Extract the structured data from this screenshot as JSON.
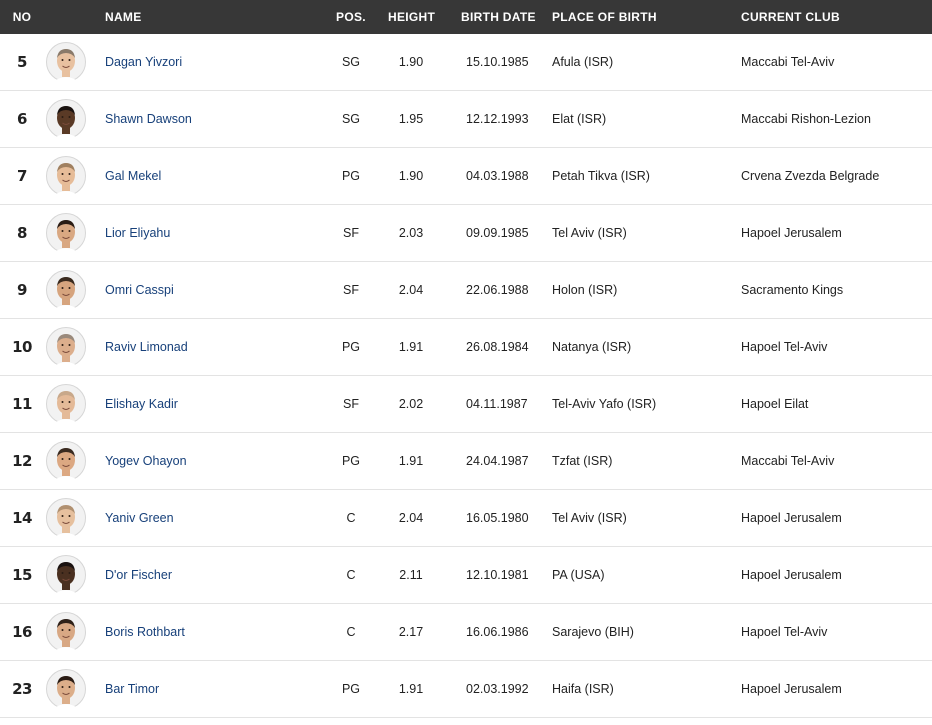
{
  "headers": {
    "no": "NO",
    "name": "NAME",
    "pos": "POS.",
    "height": "HEIGHT",
    "birth_date": "BIRTH DATE",
    "place_of_birth": "PLACE OF BIRTH",
    "current_club": "CURRENT CLUB"
  },
  "colors": {
    "header_bg": "#373737",
    "name_link": "#17407a",
    "row_divider": "#e3e3e3"
  },
  "players": [
    {
      "no": "5",
      "name": "Dagan Yivzori",
      "pos": "SG",
      "height": "1.90",
      "birth_date": "15.10.1985",
      "place": "Afula (ISR)",
      "club": "Maccabi Tel-Aviv",
      "skin": "#e8c1a0",
      "hair": "#8a7a6a"
    },
    {
      "no": "6",
      "name": "Shawn Dawson",
      "pos": "SG",
      "height": "1.95",
      "birth_date": "12.12.1993",
      "place": "Elat (ISR)",
      "club": "Maccabi Rishon-Lezion",
      "skin": "#5a3a26",
      "hair": "#1a1210"
    },
    {
      "no": "7",
      "name": "Gal Mekel",
      "pos": "PG",
      "height": "1.90",
      "birth_date": "04.03.1988",
      "place": "Petah Tikva (ISR)",
      "club": "Crvena Zvezda Belgrade",
      "skin": "#e6bc98",
      "hair": "#a08060"
    },
    {
      "no": "8",
      "name": "Lior Eliyahu",
      "pos": "SF",
      "height": "2.03",
      "birth_date": "09.09.1985",
      "place": "Tel Aviv (ISR)",
      "club": "Hapoel Jerusalem",
      "skin": "#d9a882",
      "hair": "#2a1c14"
    },
    {
      "no": "9",
      "name": "Omri Casspi",
      "pos": "SF",
      "height": "2.04",
      "birth_date": "22.06.1988",
      "place": "Holon (ISR)",
      "club": "Sacramento Kings",
      "skin": "#d6a47e",
      "hair": "#3a2a1e"
    },
    {
      "no": "10",
      "name": "Raviv Limonad",
      "pos": "PG",
      "height": "1.91",
      "birth_date": "26.08.1984",
      "place": "Natanya (ISR)",
      "club": "Hapoel Tel-Aviv",
      "skin": "#dcae8c",
      "hair": "#9a8a7c"
    },
    {
      "no": "11",
      "name": "Elishay Kadir",
      "pos": "SF",
      "height": "2.02",
      "birth_date": "04.11.1987",
      "place": "Tel-Aviv Yafo (ISR)",
      "club": "Hapoel Eilat",
      "skin": "#e4ba98",
      "hair": "#c8a88a"
    },
    {
      "no": "12",
      "name": "Yogev Ohayon",
      "pos": "PG",
      "height": "1.91",
      "birth_date": "24.04.1987",
      "place": "Tzfat (ISR)",
      "club": "Maccabi Tel-Aviv",
      "skin": "#dca882",
      "hair": "#3a2a20"
    },
    {
      "no": "14",
      "name": "Yaniv Green",
      "pos": "C",
      "height": "2.04",
      "birth_date": "16.05.1980",
      "place": "Tel Aviv (ISR)",
      "club": "Hapoel Jerusalem",
      "skin": "#e6c09e",
      "hair": "#b09070"
    },
    {
      "no": "15",
      "name": "D'or Fischer",
      "pos": "C",
      "height": "2.11",
      "birth_date": "12.10.1981",
      "place": "PA (USA)",
      "club": "Hapoel Jerusalem",
      "skin": "#4a3020",
      "hair": "#1a1210"
    },
    {
      "no": "16",
      "name": "Boris Rothbart",
      "pos": "C",
      "height": "2.17",
      "birth_date": "16.06.1986",
      "place": "Sarajevo (BIH)",
      "club": "Hapoel Tel-Aviv",
      "skin": "#d8a884",
      "hair": "#2e2018"
    },
    {
      "no": "23",
      "name": "Bar Timor",
      "pos": "PG",
      "height": "1.91",
      "birth_date": "02.03.1992",
      "place": "Haifa (ISR)",
      "club": "Hapoel Jerusalem",
      "skin": "#dcae8a",
      "hair": "#2a1c14"
    }
  ]
}
